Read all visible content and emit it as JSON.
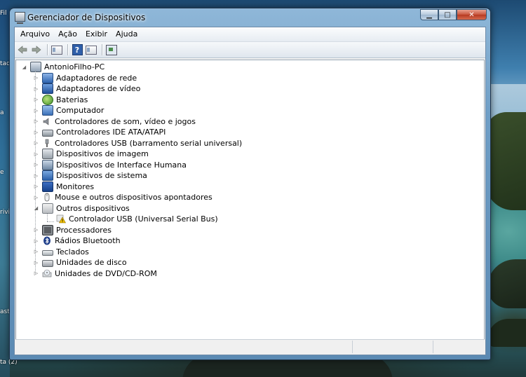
{
  "window": {
    "title": "Gerenciador de Dispositivos",
    "buttons": {
      "minimize": "▁",
      "maximize": "□",
      "close": "✕"
    }
  },
  "menu": [
    "Arquivo",
    "Ação",
    "Exibir",
    "Ajuda"
  ],
  "toolbar": [
    "back-arrow-icon",
    "forward-arrow-icon",
    "show-hide-console-tree-icon",
    "help-icon",
    "properties-icon",
    "scan-hardware-icon"
  ],
  "desktop": {
    "labels": [
      "Fil",
      "tad",
      "a",
      "e",
      "rivi",
      "ast",
      "ta (2)"
    ]
  },
  "tree": {
    "root": "AntonioFilho-PC",
    "categories": [
      {
        "label": "Adaptadores de rede",
        "icon": "network-adapter-icon",
        "expanded": false
      },
      {
        "label": "Adaptadores de vídeo",
        "icon": "display-adapter-icon",
        "expanded": false
      },
      {
        "label": "Baterias",
        "icon": "battery-icon",
        "expanded": false
      },
      {
        "label": "Computador",
        "icon": "computer-icon",
        "expanded": false
      },
      {
        "label": "Controladores de som, vídeo e jogos",
        "icon": "speaker-icon",
        "expanded": false
      },
      {
        "label": "Controladores IDE ATA/ATAPI",
        "icon": "ide-controller-icon",
        "expanded": false
      },
      {
        "label": "Controladores USB (barramento serial universal)",
        "icon": "usb-plug-icon",
        "expanded": false
      },
      {
        "label": "Dispositivos de imagem",
        "icon": "scanner-icon",
        "expanded": false
      },
      {
        "label": "Dispositivos de Interface Humana",
        "icon": "hid-icon",
        "expanded": false
      },
      {
        "label": "Dispositivos de sistema",
        "icon": "system-device-icon",
        "expanded": false
      },
      {
        "label": "Monitores",
        "icon": "monitor-icon",
        "expanded": false
      },
      {
        "label": "Mouse e outros dispositivos apontadores",
        "icon": "mouse-icon",
        "expanded": false
      },
      {
        "label": "Outros dispositivos",
        "icon": "unknown-device-icon",
        "expanded": true,
        "children": [
          {
            "label": "Controlador USB (Universal Serial Bus)",
            "icon": "warning-device-icon"
          }
        ]
      },
      {
        "label": "Processadores",
        "icon": "processor-icon",
        "expanded": false
      },
      {
        "label": "Rádios Bluetooth",
        "icon": "bluetooth-icon",
        "expanded": false
      },
      {
        "label": "Teclados",
        "icon": "keyboard-icon",
        "expanded": false
      },
      {
        "label": "Unidades de disco",
        "icon": "disk-drive-icon",
        "expanded": false
      },
      {
        "label": "Unidades de DVD/CD-ROM",
        "icon": "dvd-drive-icon",
        "expanded": false
      }
    ]
  },
  "colors": {
    "window_frame": "#6f9fc7",
    "close_button": "#c8553c",
    "tree_background": "#ffffff"
  }
}
